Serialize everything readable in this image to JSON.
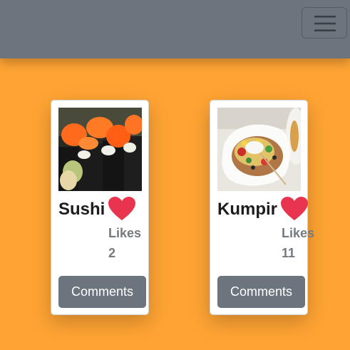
{
  "navbar": {
    "toggler_icon": "hamburger-menu-icon"
  },
  "colors": {
    "page_background": "#ffa434",
    "navbar": "#6c757d",
    "heart": "#e8344f",
    "button": "#6c757d"
  },
  "posts": [
    {
      "title": "Sushi",
      "likes_label": "Likes",
      "likes_count": "2",
      "comments_label": "Comments",
      "like_icon": "heart-icon"
    },
    {
      "title": "Kumpir",
      "likes_label": "Likes",
      "likes_count": "11",
      "comments_label": "Comments",
      "like_icon": "heart-icon"
    }
  ]
}
